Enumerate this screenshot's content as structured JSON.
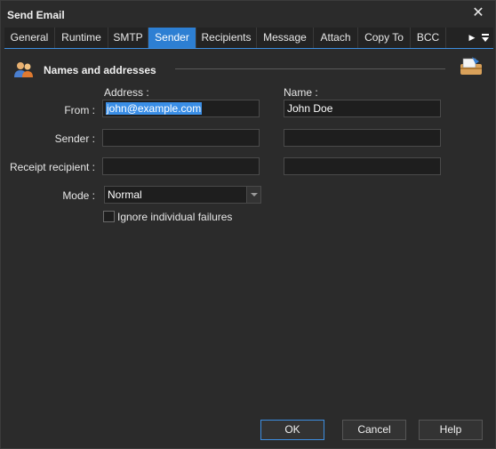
{
  "window": {
    "title": "Send Email"
  },
  "tabs": [
    {
      "label": "General"
    },
    {
      "label": "Runtime"
    },
    {
      "label": "SMTP"
    },
    {
      "label": "Sender",
      "active": true
    },
    {
      "label": "Recipients"
    },
    {
      "label": "Message"
    },
    {
      "label": "Attach"
    },
    {
      "label": "Copy To"
    },
    {
      "label": "BCC"
    }
  ],
  "section": {
    "title": "Names and addresses"
  },
  "columns": {
    "address": "Address :",
    "name": "Name :"
  },
  "rows": {
    "from": {
      "label": "From :",
      "address": "john@example.com",
      "name": "John Doe"
    },
    "sender": {
      "label": "Sender :",
      "address": "",
      "name": ""
    },
    "receipt": {
      "label": "Receipt recipient :",
      "address": "",
      "name": ""
    }
  },
  "mode": {
    "label": "Mode :",
    "value": "Normal"
  },
  "ignore_failures": {
    "label": "Ignore individual failures",
    "checked": false
  },
  "footer": {
    "ok": "OK",
    "cancel": "Cancel",
    "help": "Help"
  },
  "colors": {
    "accent": "#2d7fd3",
    "background": "#2b2b2b",
    "field": "#1e1e1e"
  }
}
